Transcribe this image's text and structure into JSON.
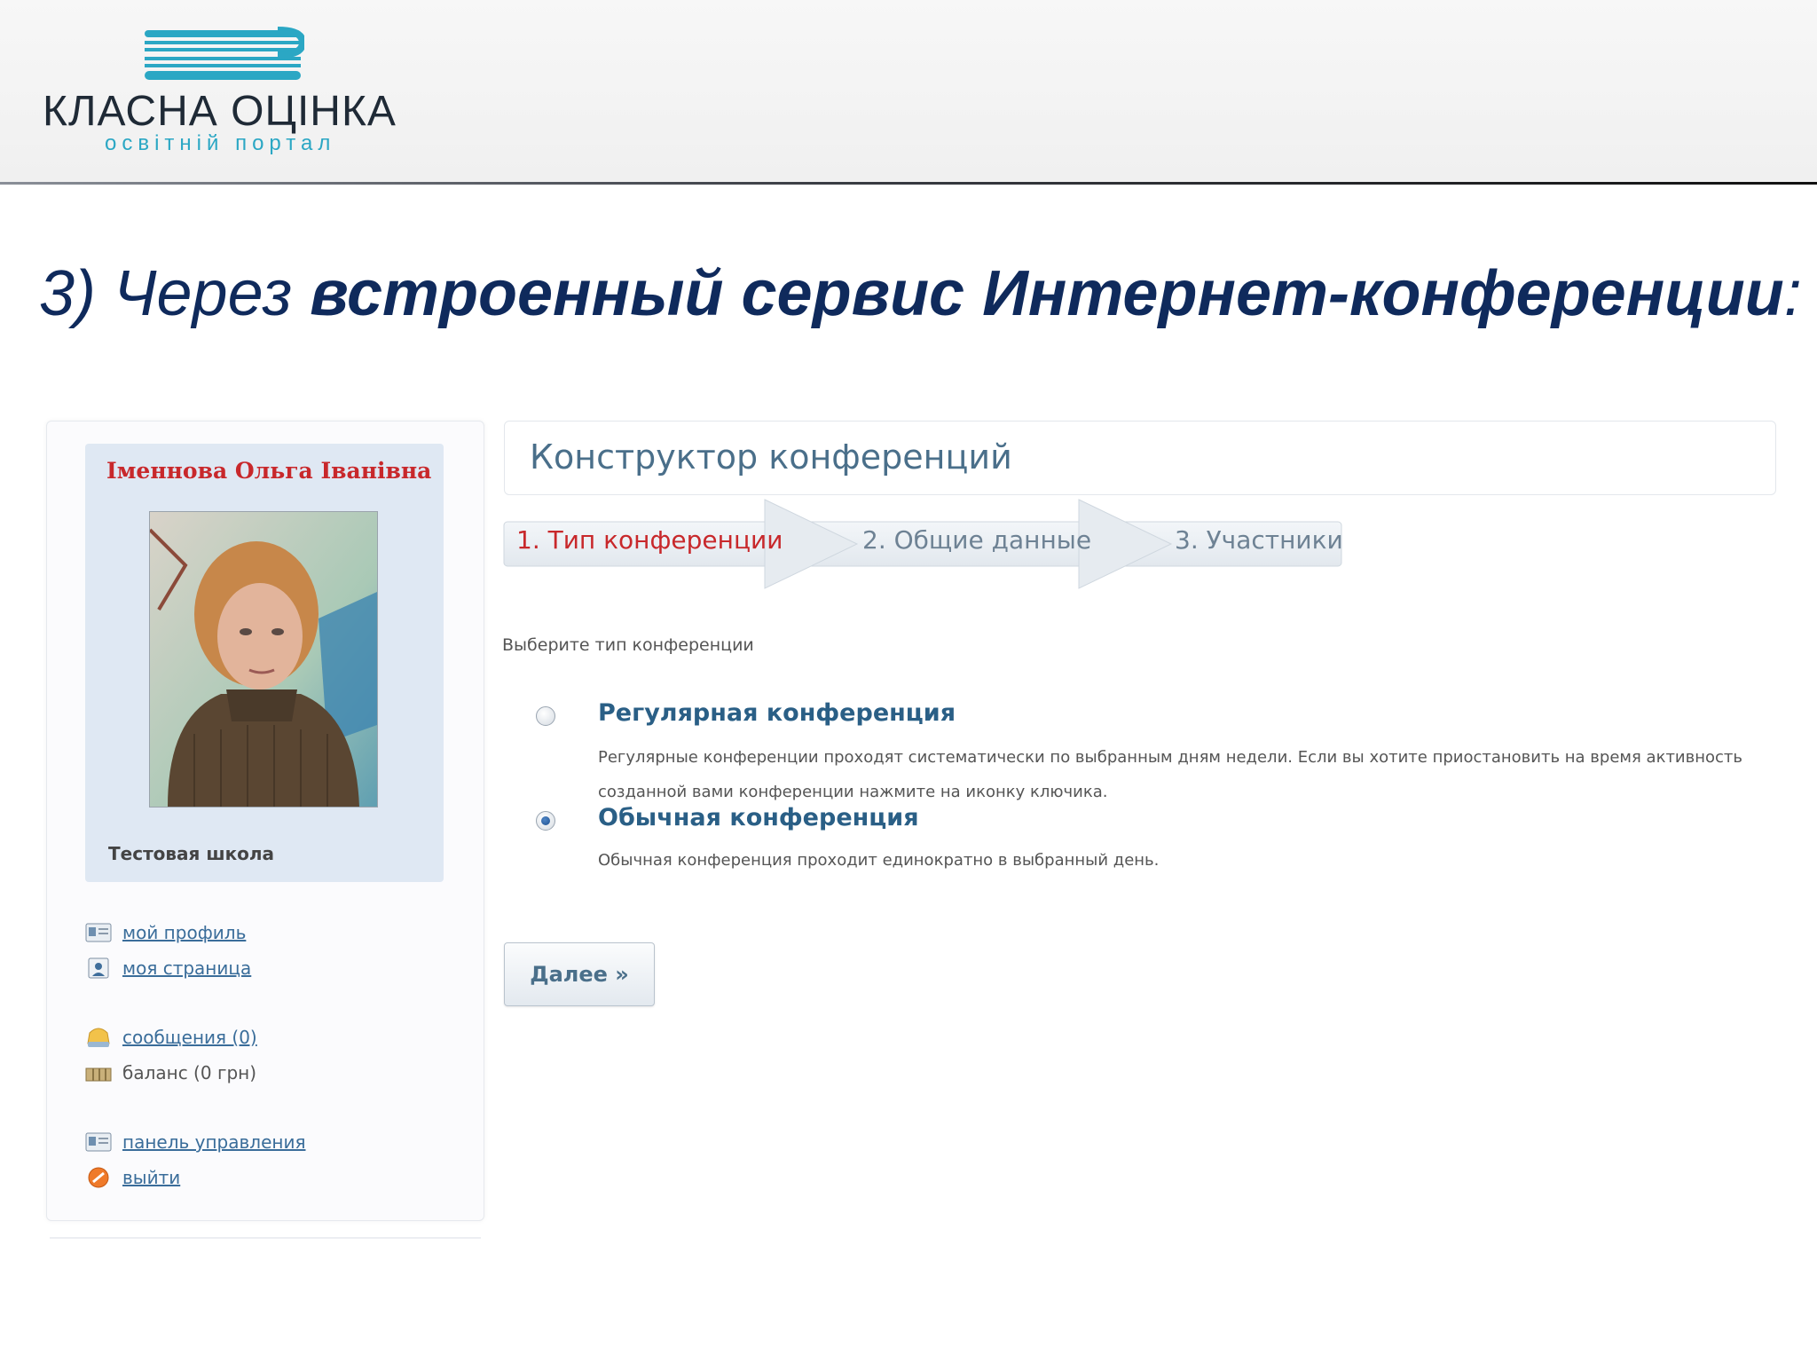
{
  "header": {
    "logo_title": "КЛАСНА ОЦІНКА",
    "logo_subtitle": "освітній портал"
  },
  "slide_title": {
    "prefix": "3) Через ",
    "emphasis": "встроенный сервис Интернет-конференции",
    "suffix": ":"
  },
  "profile": {
    "name": "Іменнова Ольга Іванівна",
    "school": "Тестовая школа"
  },
  "sidebar": {
    "links": [
      {
        "label": "мой профиль",
        "icon": "profile-card-icon",
        "link": true
      },
      {
        "label": "моя страница",
        "icon": "user-page-icon",
        "link": true
      },
      {
        "label": "сообщения (0)",
        "icon": "messages-icon",
        "link": true
      },
      {
        "label": "баланс (0 грн)",
        "icon": "balance-icon",
        "link": false
      },
      {
        "label": "панель управления",
        "icon": "control-panel-icon",
        "link": true
      },
      {
        "label": "выйти",
        "icon": "logout-icon",
        "link": true
      }
    ]
  },
  "builder": {
    "title": "Конструктор конференций",
    "steps": [
      {
        "label": "1. Тип конференции",
        "active": true
      },
      {
        "label": "2. Общие данные",
        "active": false
      },
      {
        "label": "3. Участники",
        "active": false
      }
    ],
    "choose_label": "Выберите тип конференции",
    "options": [
      {
        "title": "Регулярная конференция",
        "description": "Регулярные конференции проходят систематически по выбранным дням недели. Если вы хотите приостановить на время активность созданной вами конференции нажмите на иконку ключика.",
        "selected": false
      },
      {
        "title": "Обычная конференция",
        "description": "Обычная конференция проходит единократно в выбранный день.",
        "selected": true
      }
    ],
    "next_button": "Далее »"
  },
  "colors": {
    "title_blue": "#0f2a5c",
    "active_step_red": "#c8282b",
    "link_blue": "#3a6d9a",
    "logo_teal": "#2ba7c4"
  }
}
